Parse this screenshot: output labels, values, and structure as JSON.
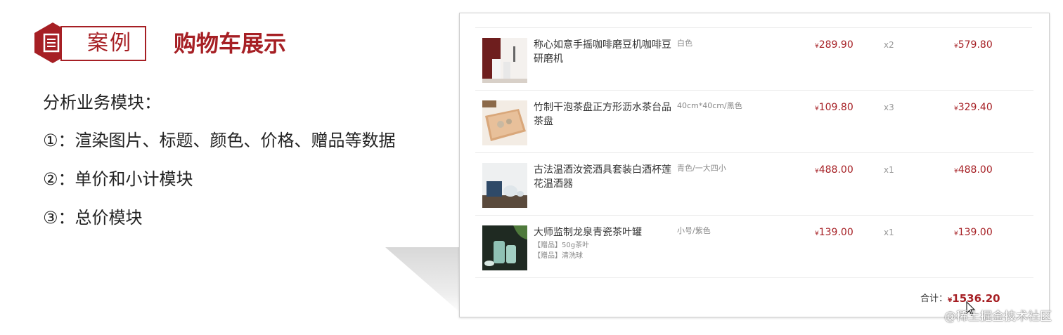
{
  "slide": {
    "tag": "案例",
    "title": "购物车展示",
    "points": [
      "分析业务模块：",
      "①：渲染图片、标题、颜色、价格、赠品等数据",
      "②：单价和小计模块",
      "③：总价模块"
    ]
  },
  "cart": {
    "items": [
      {
        "name": "称心如意手摇咖啡磨豆机咖啡豆研磨机",
        "attr": "白色",
        "price": "289.90",
        "qty": "x2",
        "subtotal": "579.80",
        "gifts": []
      },
      {
        "name": "竹制干泡茶盘正方形沥水茶台品茶盘",
        "attr": "40cm*40cm/黑色",
        "price": "109.80",
        "qty": "x3",
        "subtotal": "329.40",
        "gifts": []
      },
      {
        "name": "古法温酒汝瓷酒具套装白酒杯莲花温酒器",
        "attr": "青色/一大四小",
        "price": "488.00",
        "qty": "x1",
        "subtotal": "488.00",
        "gifts": []
      },
      {
        "name": "大师监制龙泉青瓷茶叶罐",
        "attr": "小号/紫色",
        "price": "139.00",
        "qty": "x1",
        "subtotal": "139.00",
        "gifts": [
          "【赠品】50g茶叶",
          "【赠品】清洗球"
        ]
      }
    ],
    "currency": "¥",
    "total_label": "合计：",
    "total": "1536.20"
  },
  "watermark": "@稀土掘金技术社区",
  "colors": {
    "accent": "#a61f24",
    "muted": "#888888"
  },
  "icons": {
    "badge": "document-icon",
    "cursor": "mouse-pointer-icon"
  }
}
